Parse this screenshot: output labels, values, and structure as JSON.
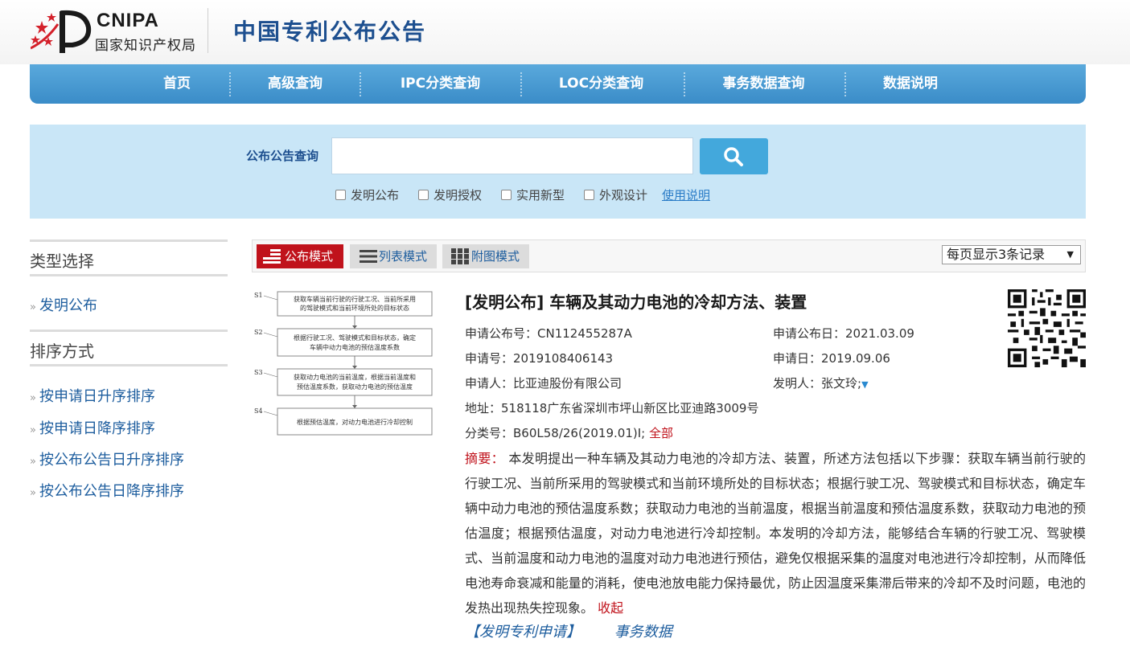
{
  "header": {
    "logo_en": "CNIPA",
    "logo_cn": "国家知识产权局",
    "title": "中国专利公布公告"
  },
  "nav": {
    "items": [
      "首页",
      "高级查询",
      "IPC分类查询",
      "LOC分类查询",
      "事务数据查询",
      "数据说明"
    ]
  },
  "search": {
    "label": "公布公告查询",
    "value": "",
    "button_icon": "search-icon",
    "filters": [
      "发明公布",
      "发明授权",
      "实用新型",
      "外观设计"
    ],
    "help_link": "使用说明"
  },
  "sidebar": {
    "type_heading": "类型选择",
    "type_items": [
      "发明公布"
    ],
    "sort_heading": "排序方式",
    "sort_items": [
      "按申请日升序排序",
      "按申请日降序排序",
      "按公布公告日升序排序",
      "按公布公告日降序排序"
    ]
  },
  "toolbar": {
    "modes": [
      "公布模式",
      "列表模式",
      "附图模式"
    ],
    "mode_icons": [
      "flag-icon",
      "list-icon",
      "grid-icon"
    ],
    "page_size": "每页显示3条记录"
  },
  "diagram": {
    "steps": [
      {
        "label": "S1",
        "lines": [
          "获取车辆当前行驶的行驶工况、当前所采用",
          "的驾驶模式和当前环境所处的目标状态"
        ]
      },
      {
        "label": "S2",
        "lines": [
          "根据行驶工况、驾驶模式和目标状态，确定",
          "车辆中动力电池的预估温度系数"
        ]
      },
      {
        "label": "S3",
        "lines": [
          "获取动力电池的当前温度，根据当前温度和",
          "预估温度系数，获取动力电池的预估温度"
        ]
      },
      {
        "label": "S4",
        "lines": [
          "根据预估温度，对动力电池进行冷却控制"
        ]
      }
    ]
  },
  "record": {
    "title": "[发明公布] 车辆及其动力电池的冷却方法、装置",
    "pub_no_label": "申请公布号：",
    "pub_no": "CN112455287A",
    "pub_date_label": "申请公布日：",
    "pub_date": "2021.03.09",
    "app_no_label": "申请号：",
    "app_no": "2019108406143",
    "app_date_label": "申请日：",
    "app_date": "2019.09.06",
    "applicant_label": "申请人：",
    "applicant": "比亚迪股份有限公司",
    "inventor_label": "发明人：",
    "inventor": "张文玲;",
    "address_label": "地址：",
    "address": "518118广东省深圳市坪山新区比亚迪路3009号",
    "class_label": "分类号：",
    "class_no": "B60L58/26(2019.01)I;",
    "class_all": "全部",
    "abstract_label": "摘要：",
    "abstract": "本发明提出一种车辆及其动力电池的冷却方法、装置，所述方法包括以下步骤：获取车辆当前行驶的行驶工况、当前所采用的驾驶模式和当前环境所处的目标状态；根据行驶工况、驾驶模式和目标状态，确定车辆中动力电池的预估温度系数；获取动力电池的当前温度，根据当前温度和预估温度系数，获取动力电池的预估温度；根据预估温度，对动力电池进行冷却控制。本发明的冷却方法，能够结合车辆的行驶工况、驾驶模式、当前温度和动力电池的温度对动力电池进行预估，避免仅根据采集的温度对电池进行冷却控制，从而降低电池寿命衰减和能量的消耗，使电池放电能力保持最优，防止因温度采集滞后带来的冷却不及时问题，电池的发热出现热失控现象。",
    "collapse": "收起",
    "link_application": "【发明专利申请】",
    "link_transactions": "事务数据"
  },
  "colors": {
    "brand_blue": "#1d4f8f",
    "nav_blue": "#3a8cc8",
    "search_bg": "#c9e6f7",
    "accent_red": "#c0121b",
    "link_blue": "#1d5d9e"
  }
}
